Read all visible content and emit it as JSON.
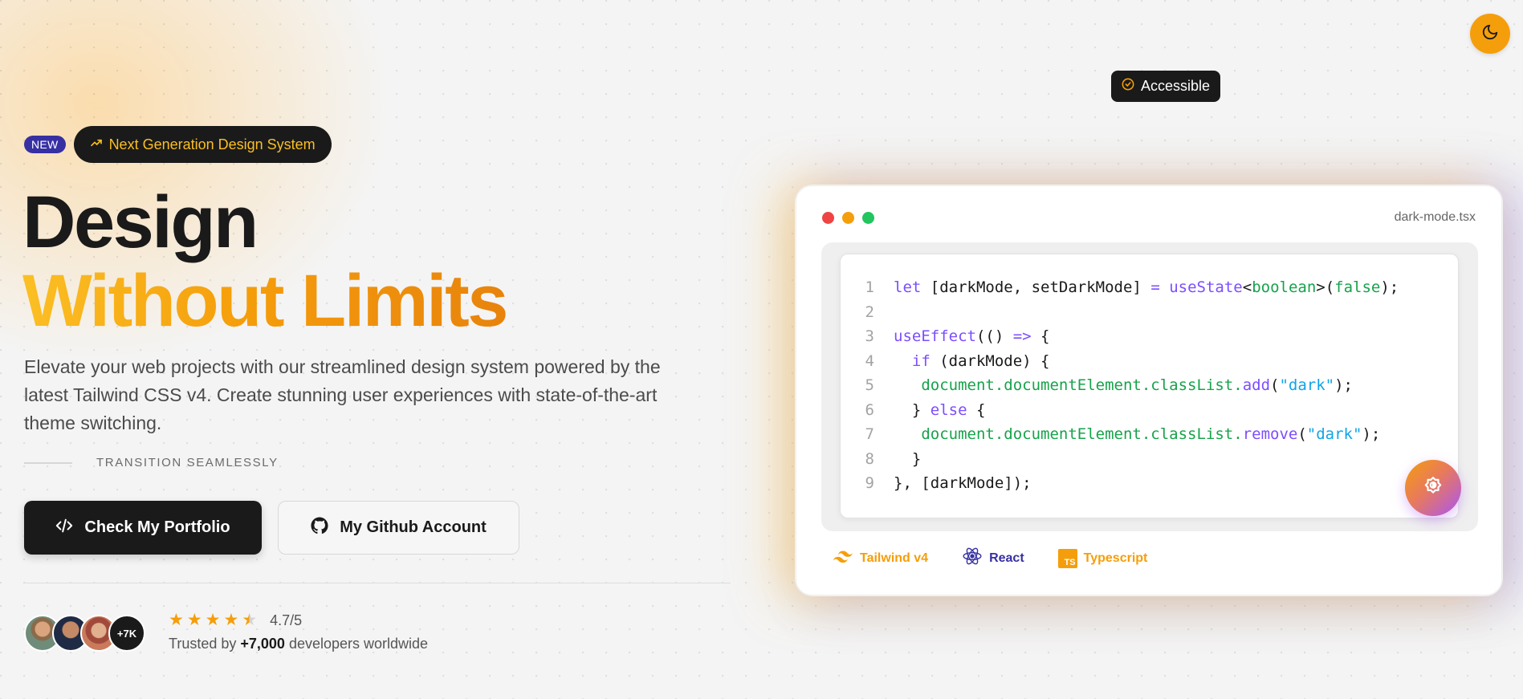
{
  "badges": {
    "new": "NEW",
    "pill": "Next Generation Design System"
  },
  "headline": {
    "line1": "Design",
    "line2": "Without Limits"
  },
  "description": "Elevate your web projects with our streamlined design system powered by the latest Tailwind CSS v4. Create stunning user experiences with state-of-the-art theme switching.",
  "transition_label": "TRANSITION SEAMLESSLY",
  "buttons": {
    "portfolio": "Check My Portfolio",
    "github": "My Github Account"
  },
  "social_proof": {
    "extra_count": "+7K",
    "rating": "4.7/5",
    "stars": 4.5,
    "trusted_prefix": "Trusted by",
    "trusted_count": "+7,000",
    "trusted_suffix": "developers worldwide"
  },
  "accessible_tag": "Accessible",
  "code_card": {
    "filename": "dark-mode.tsx",
    "line_numbers": [
      "1",
      "2",
      "3",
      "4",
      "5",
      "6",
      "7",
      "8",
      "9"
    ],
    "window_dot_colors": [
      "#ef4444",
      "#f59e0b",
      "#22c55e"
    ],
    "code": {
      "l1_a": "let",
      "l1_b": " [darkMode, setDarkMode] ",
      "l1_c": "=",
      "l1_d": " ",
      "l1_e": "useState",
      "l1_f": "<",
      "l1_g": "boolean",
      "l1_h": ">(",
      "l1_i": "false",
      "l1_j": ");",
      "l3_a": "useEffect",
      "l3_b": "(() ",
      "l3_c": "=>",
      "l3_d": " {",
      "l4_a": "  ",
      "l4_b": "if",
      "l4_c": " (darkMode) {",
      "l5_a": "   document.documentElement.classList.",
      "l5_b": "add",
      "l5_c": "(",
      "l5_d": "\"dark\"",
      "l5_e": ");",
      "l6_a": "  } ",
      "l6_b": "else",
      "l6_c": " {",
      "l7_a": "   document.documentElement.classList.",
      "l7_b": "remove",
      "l7_c": "(",
      "l7_d": "\"dark\"",
      "l7_e": ");",
      "l8": "  }",
      "l9": "}, [darkMode]);"
    },
    "tech": {
      "tailwind": "Tailwind v4",
      "react": "React",
      "typescript": "Typescript",
      "ts_badge": "TS"
    }
  },
  "colors": {
    "accent": "#f59e0b",
    "dark": "#1a1a1a",
    "indigo": "#3730a3",
    "purple": "#a855f7"
  },
  "icons": {
    "theme_toggle": "moon-icon",
    "pill": "trending-up-icon",
    "portfolio": "code-icon",
    "github": "github-icon",
    "accessible": "check-circle-icon",
    "float": "sun-moon-icon"
  }
}
